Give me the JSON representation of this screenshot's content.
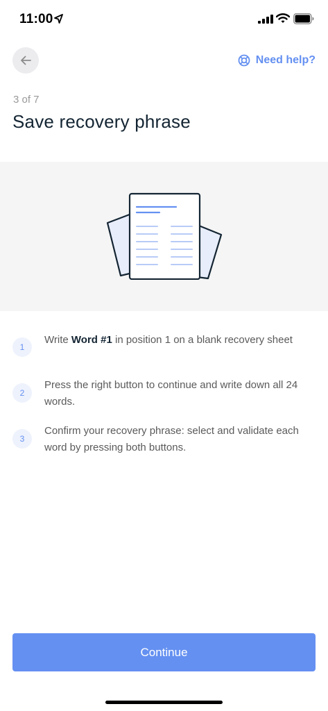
{
  "status_bar": {
    "time": "11:00"
  },
  "header": {
    "back_icon": "arrow-left-icon",
    "help_label": "Need help?",
    "help_icon": "lifebuoy-icon"
  },
  "step_counter": "3 of 7",
  "title": "Save recovery phrase",
  "instructions": [
    {
      "number": "1",
      "text_before": "Write ",
      "bold": "Word #1",
      "text_after": " in position 1 on a blank recovery sheet"
    },
    {
      "number": "2",
      "text": "Press the right button to continue and write down all 24 words."
    },
    {
      "number": "3",
      "text": "Confirm your recovery phrase: select and validate each word by pressing both buttons."
    }
  ],
  "continue_label": "Continue",
  "colors": {
    "accent": "#6490f1",
    "text": "#142533",
    "muted": "#999999",
    "panel": "#f5f5f5"
  }
}
